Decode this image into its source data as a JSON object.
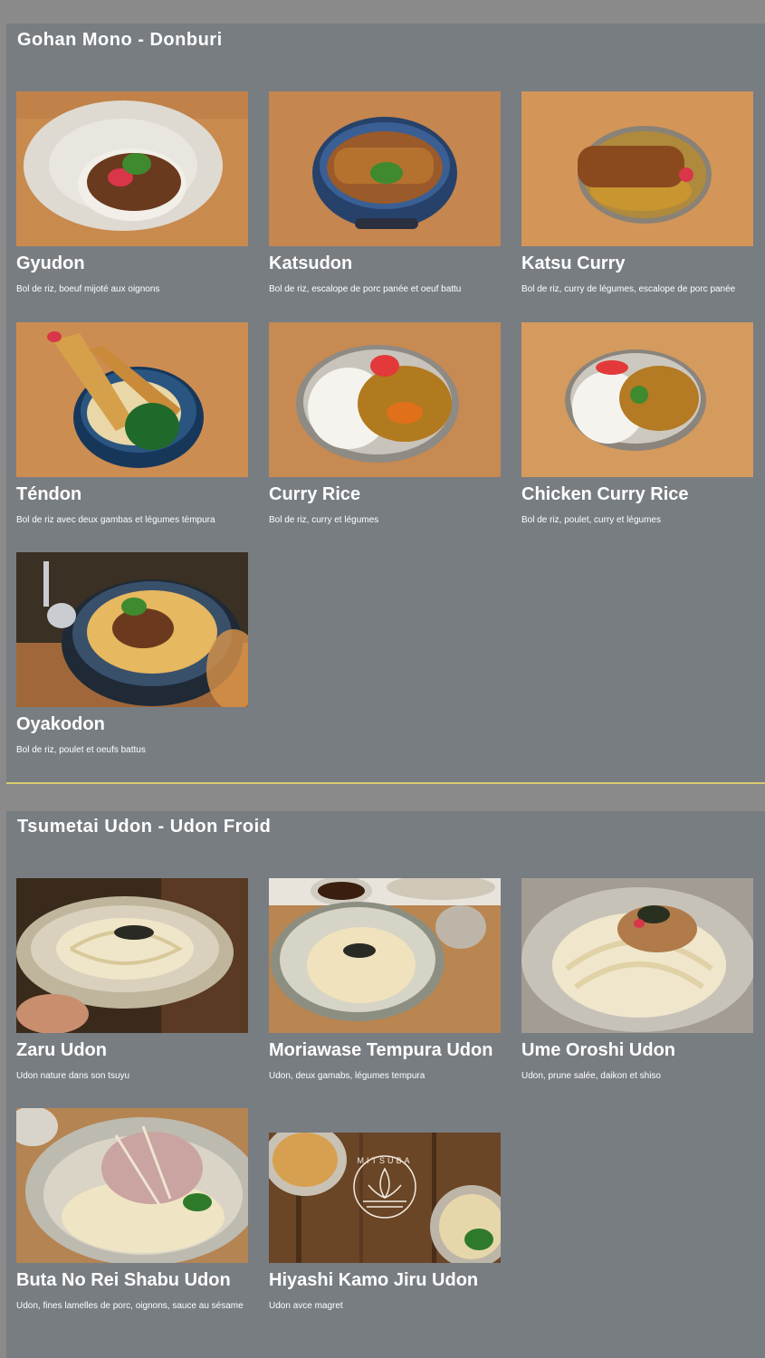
{
  "sections": [
    {
      "title": "Gohan Mono - Donburi",
      "items": [
        {
          "name": "Gyudon",
          "desc": "Bol de riz, boeuf mijoté aux oignons",
          "icon": "gyudon-bowl-photo"
        },
        {
          "name": "Katsudon",
          "desc": "Bol de riz, escalope de porc panée et oeuf battu",
          "icon": "katsudon-bowl-photo"
        },
        {
          "name": "Katsu Curry",
          "desc": "Bol de riz, curry de légumes, escalope de porc panée",
          "icon": "katsu-curry-photo"
        },
        {
          "name": "Téndon",
          "desc": "Bol de riz avec deux gambas et légumes tèmpura",
          "icon": "tendon-bowl-photo"
        },
        {
          "name": "Curry Rice",
          "desc": "Bol de riz, curry et légumes",
          "icon": "curry-rice-photo"
        },
        {
          "name": "Chicken Curry Rice",
          "desc": "Bol de riz, poulet, curry et légumes",
          "icon": "chicken-curry-rice-photo"
        },
        {
          "name": "Oyakodon",
          "desc": "Bol de riz, poulet et oeufs battus",
          "icon": "oyakodon-bowl-photo"
        }
      ]
    },
    {
      "title": "Tsumetai Udon - Udon Froid",
      "items": [
        {
          "name": "Zaru Udon",
          "desc": "Udon nature dans son tsuyu",
          "icon": "zaru-udon-photo"
        },
        {
          "name": "Moriawase Tempura Udon",
          "desc": "Udon, deux gamabs, légumes tempura",
          "icon": "moriawase-udon-photo"
        },
        {
          "name": "Ume Oroshi Udon",
          "desc": "Udon, prune salée, daikon et shiso",
          "icon": "ume-oroshi-udon-photo"
        },
        {
          "name": "Buta No Rei Shabu Udon",
          "desc": "Udon, fines lamelles de porc, oignons, sauce au sésame",
          "icon": "buta-shabu-udon-photo"
        },
        {
          "name": "Hiyashi Kamo Jiru Udon",
          "desc": "Udon avce magret",
          "icon": "mitsuba-logo-photo"
        }
      ]
    }
  ],
  "logo_text": "MITSUBA",
  "colors": {
    "page": "#8a8a8a",
    "section": "#787d82",
    "divider": "#d9cc6c",
    "text": "#ffffff",
    "wood": "#c98a4e"
  }
}
